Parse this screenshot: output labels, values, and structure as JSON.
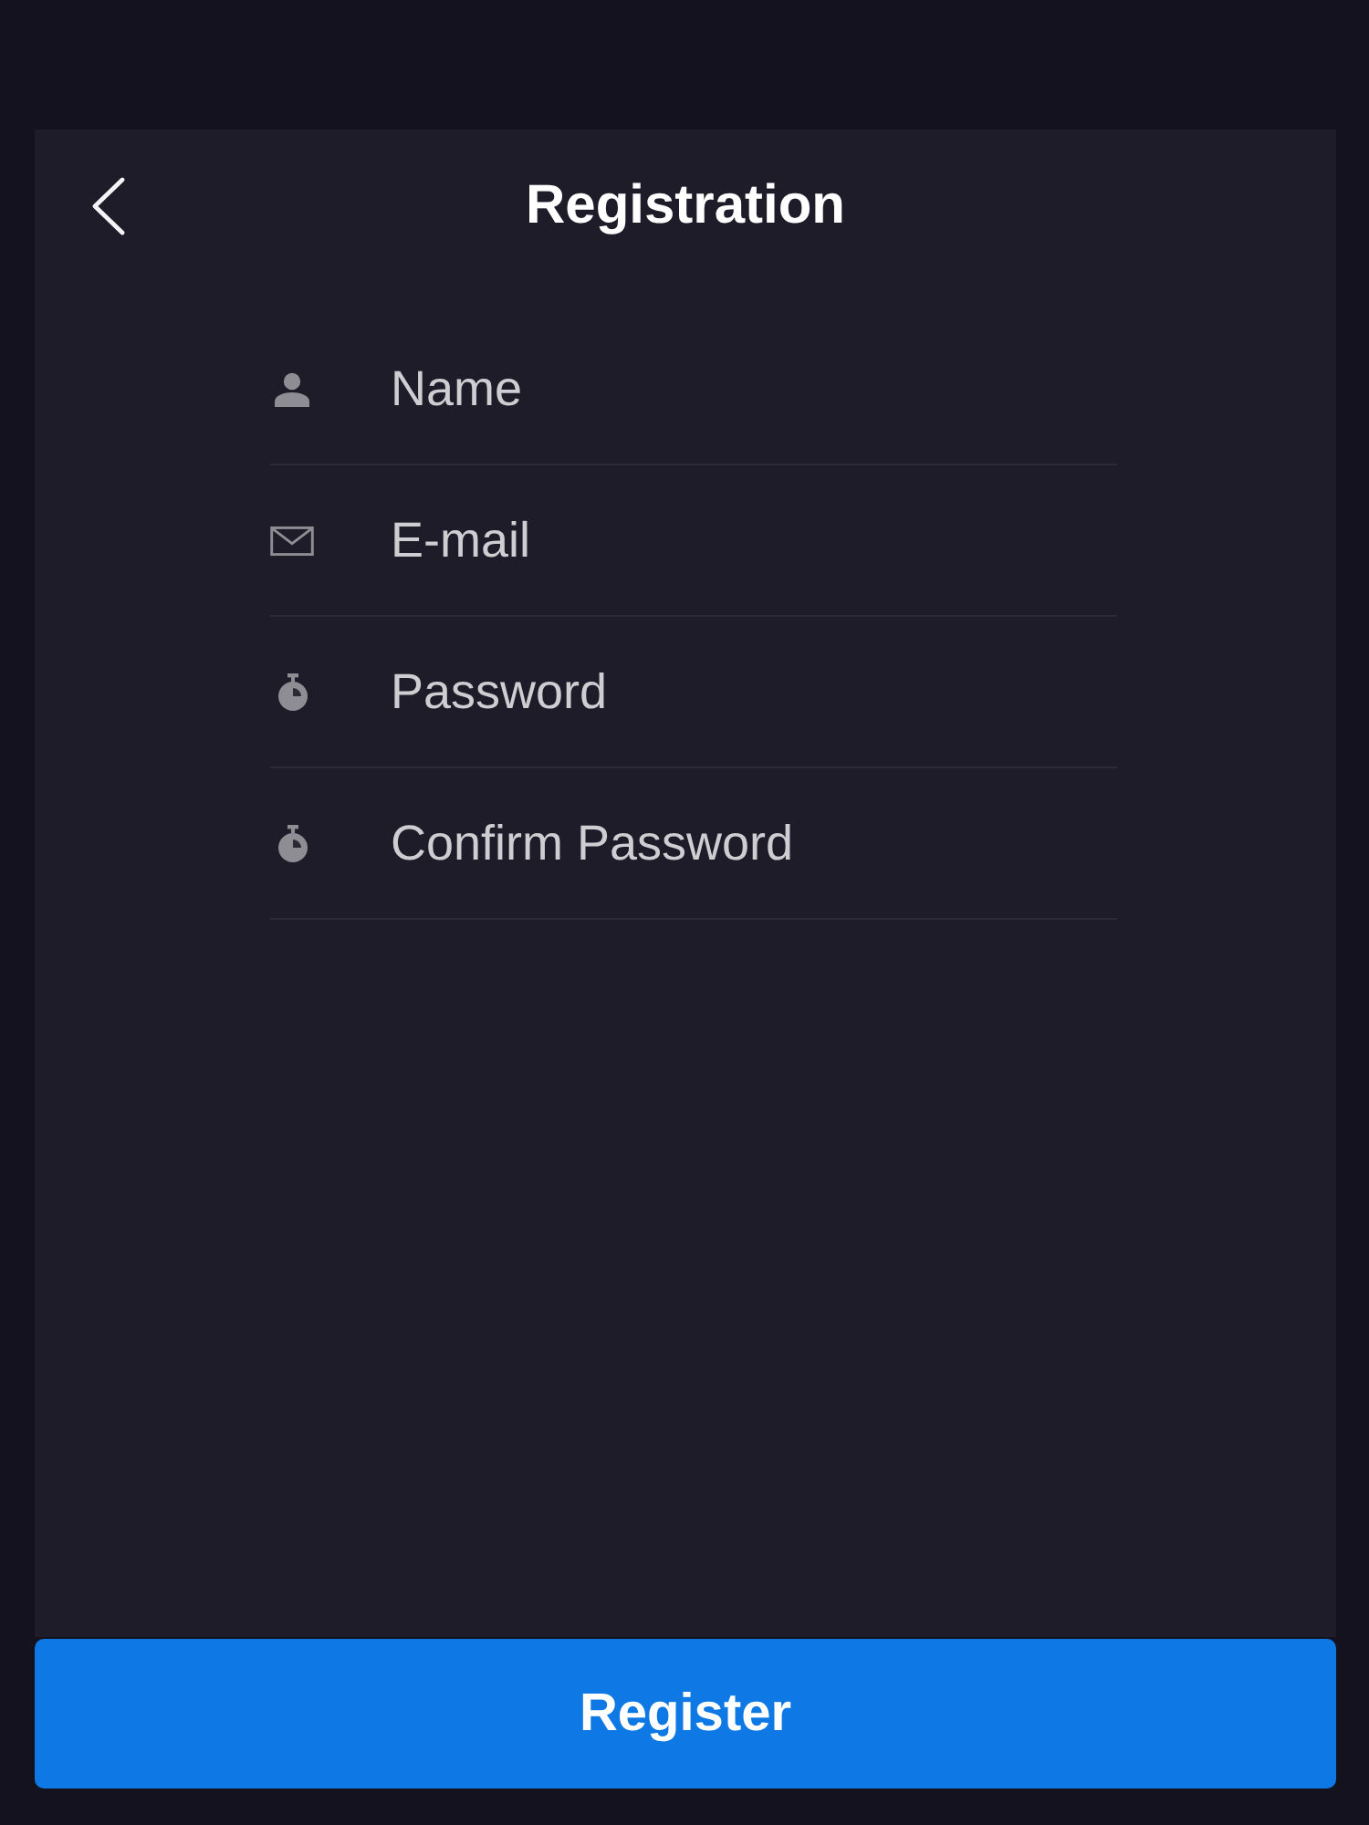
{
  "header": {
    "title": "Registration"
  },
  "fields": [
    {
      "kind": "name",
      "placeholder": "Name"
    },
    {
      "kind": "email",
      "placeholder": "E-mail"
    },
    {
      "kind": "password",
      "placeholder": "Password"
    },
    {
      "kind": "password",
      "placeholder": "Confirm Password"
    }
  ],
  "submit_button": {
    "label": "Register"
  }
}
